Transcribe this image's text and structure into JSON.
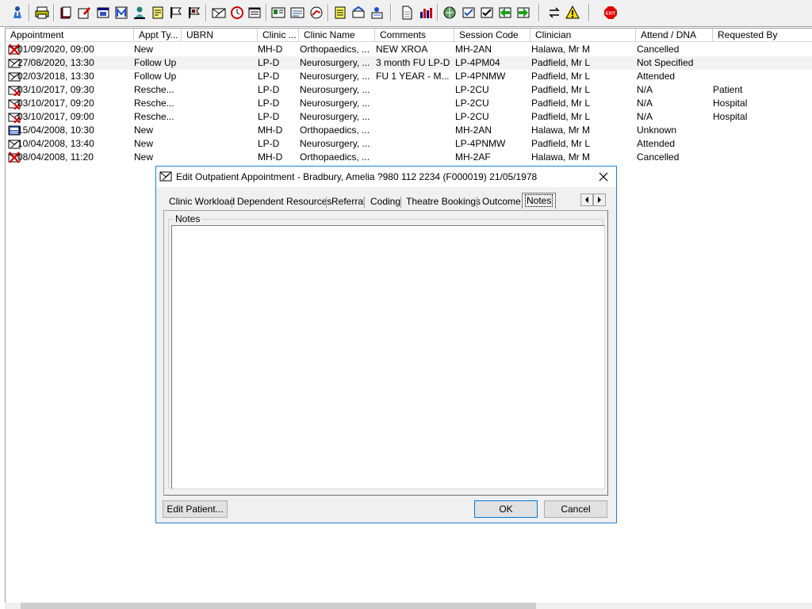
{
  "toolbar": {
    "buttons": [
      "patient-icon",
      "print-icon",
      "book-red-icon",
      "edit-form-icon",
      "calendar-icon",
      "mail-icon",
      "person-icon",
      "note-icon",
      "flag-icon",
      "flag2-icon",
      "envelope-icon",
      "clock-icon",
      "window-icon",
      "id-card-icon",
      "form-icon",
      "globe-icon",
      "notepad-icon",
      "transfer-icon",
      "person-edit-icon",
      "document-icon",
      "chart-icon",
      "globe2-icon",
      "check-doc-icon",
      "check-doc2-icon",
      "green-arrow-icon",
      "green-arrow2-icon",
      "swap-icon",
      "warning-icon",
      "exit-icon"
    ],
    "exit_label": "EXIT"
  },
  "list": {
    "columns": [
      "Appointment",
      "Appt Ty...",
      "UBRN",
      "Clinic ...",
      "Clinic Name",
      "Comments",
      "Session Code",
      "Clinician",
      "Attend / DNA",
      "Requested By"
    ],
    "rows": [
      {
        "appointment": "01/09/2020, 09:00",
        "type": "New",
        "ubrn": "",
        "clinic": "MH-D",
        "clinic_name": "Orthopaedics, ...",
        "comments": "NEW XROA",
        "session": "MH-2AN",
        "clinician": "Halawa, Mr M",
        "attend": "Cancelled",
        "requested": "",
        "icon": "cancelled-icon"
      },
      {
        "appointment": "27/08/2020, 13:30",
        "type": "Follow Up",
        "ubrn": "",
        "clinic": "LP-D",
        "clinic_name": "Neurosurgery, ...",
        "comments": "3 month FU LP-D",
        "session": "LP-4PM04",
        "clinician": "Padfield, Mr L",
        "attend": "Not Specified",
        "requested": "",
        "icon": "appointment-icon"
      },
      {
        "appointment": "02/03/2018, 13:30",
        "type": "Follow Up",
        "ubrn": "",
        "clinic": "LP-D",
        "clinic_name": "Neurosurgery, ...",
        "comments": "FU 1 YEAR - M...",
        "session": "LP-4PNMW",
        "clinician": "Padfield, Mr L",
        "attend": "Attended",
        "requested": "",
        "icon": "attended-icon"
      },
      {
        "appointment": "03/10/2017, 09:30",
        "type": "Resche...",
        "ubrn": "",
        "clinic": "LP-D",
        "clinic_name": "Neurosurgery, ...",
        "comments": "",
        "session": "LP-2CU",
        "clinician": "Padfield, Mr L",
        "attend": "N/A",
        "requested": "Patient",
        "icon": "rescheduled-icon"
      },
      {
        "appointment": "03/10/2017, 09:20",
        "type": "Resche...",
        "ubrn": "",
        "clinic": "LP-D",
        "clinic_name": "Neurosurgery, ...",
        "comments": "",
        "session": "LP-2CU",
        "clinician": "Padfield, Mr L",
        "attend": "N/A",
        "requested": "Hospital",
        "icon": "rescheduled-icon"
      },
      {
        "appointment": "03/10/2017, 09:00",
        "type": "Resche...",
        "ubrn": "",
        "clinic": "LP-D",
        "clinic_name": "Neurosurgery, ...",
        "comments": "",
        "session": "LP-2CU",
        "clinician": "Padfield, Mr L",
        "attend": "N/A",
        "requested": "Hospital",
        "icon": "rescheduled-icon"
      },
      {
        "appointment": "15/04/2008, 10:30",
        "type": "New",
        "ubrn": "",
        "clinic": "MH-D",
        "clinic_name": "Orthopaedics, ...",
        "comments": "",
        "session": "MH-2AN",
        "clinician": "Halawa, Mr M",
        "attend": "Unknown",
        "requested": "",
        "icon": "unknown-icon"
      },
      {
        "appointment": "10/04/2008, 13:40",
        "type": "New",
        "ubrn": "",
        "clinic": "LP-D",
        "clinic_name": "Neurosurgery, ...",
        "comments": "",
        "session": "LP-4PNMW",
        "clinician": "Padfield, Mr L",
        "attend": "Attended",
        "requested": "",
        "icon": "attended-icon"
      },
      {
        "appointment": "08/04/2008, 11:20",
        "type": "New",
        "ubrn": "",
        "clinic": "MH-D",
        "clinic_name": "Orthopaedics, ...",
        "comments": "",
        "session": "MH-2AF",
        "clinician": "Halawa, Mr M",
        "attend": "Cancelled",
        "requested": "",
        "icon": "cancelled-icon"
      }
    ]
  },
  "dialog": {
    "title": "Edit Outpatient Appointment - Bradbury, Amelia ?980 112 2234 (F000019) 21/05/1978",
    "tabs": [
      "Clinic Workload",
      "Dependent Resources",
      "Referral",
      "Coding",
      "Theatre Bookings",
      "Outcome",
      "Notes"
    ],
    "active_tab": "Notes",
    "notes_group_label": "Notes",
    "notes_value": "",
    "edit_patient_label": "Edit Patient...",
    "ok_label": "OK",
    "cancel_label": "Cancel"
  }
}
